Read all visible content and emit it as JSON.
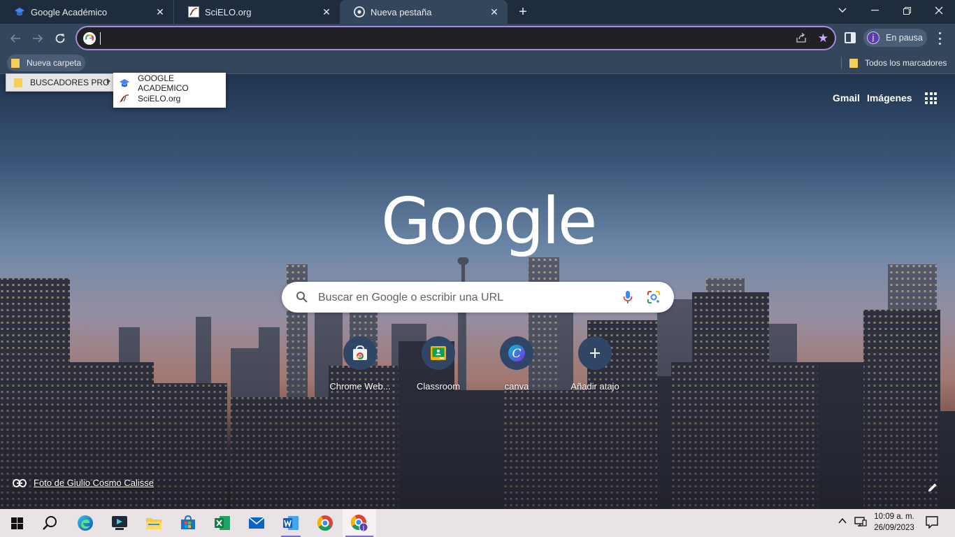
{
  "tabs": [
    {
      "title": "Google Académico",
      "close": "✕"
    },
    {
      "title": "SciELO.org",
      "close": "✕"
    },
    {
      "title": "Nueva pestaña",
      "close": "✕"
    }
  ],
  "new_tab": "+",
  "profile": {
    "initial": "j",
    "label": "En pausa"
  },
  "bookmarks": {
    "folder": "Nueva carpeta",
    "all": "Todos los marcadores",
    "submenu_folder": "BUSCADORES PRO",
    "submenu_items": [
      "GOOGLE ACADEMICO",
      "SciELO.org"
    ]
  },
  "ntp": {
    "links": {
      "gmail": "Gmail",
      "images": "Imágenes"
    },
    "logo": "Google",
    "search_placeholder": "Buscar en Google o escribir una URL",
    "shortcuts": [
      {
        "label": "Chrome Web..."
      },
      {
        "label": "Classroom"
      },
      {
        "label": "canva"
      },
      {
        "label": "Añadir atajo"
      }
    ],
    "photo_credit": "Foto de Giulio Cosmo Calisse"
  },
  "taskbar": {
    "time": "10:09 a. m.",
    "date": "26/09/2023"
  },
  "colors": {
    "accent": "#a98bd9",
    "frame": "#1e2c3d",
    "toolbar": "#34465b"
  }
}
